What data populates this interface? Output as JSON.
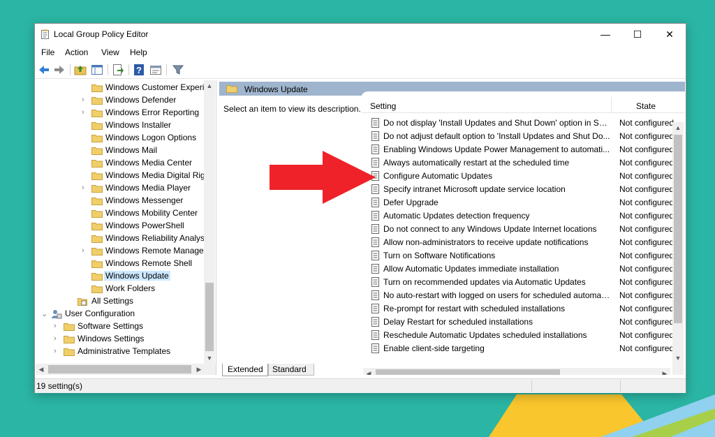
{
  "colors": {
    "desktop": "#2bb5a4",
    "accent_yellow": "#f9c62d",
    "accent_blue": "#8fd1ee",
    "arrow": "#ee2228",
    "header_bar": "#9fb4cd",
    "selected": "#cce8ff"
  },
  "window": {
    "title": "Local Group Policy Editor",
    "controls": {
      "minimize": "—",
      "maximize": "☐",
      "close": "✕"
    }
  },
  "menu": [
    "File",
    "Action",
    "View",
    "Help"
  ],
  "toolbar_icons": [
    "back-icon",
    "forward-icon",
    "up-folder-icon",
    "show-hide-tree-icon",
    "export-list-icon",
    "help-icon",
    "properties-icon",
    "filter-icon"
  ],
  "tree": [
    {
      "label": "Windows Customer Experi",
      "expandable": false
    },
    {
      "label": "Windows Defender",
      "expandable": true
    },
    {
      "label": "Windows Error Reporting",
      "expandable": true
    },
    {
      "label": "Windows Installer",
      "expandable": false
    },
    {
      "label": "Windows Logon Options",
      "expandable": false
    },
    {
      "label": "Windows Mail",
      "expandable": false
    },
    {
      "label": "Windows Media Center",
      "expandable": false
    },
    {
      "label": "Windows Media Digital Rig",
      "expandable": false
    },
    {
      "label": "Windows Media Player",
      "expandable": true
    },
    {
      "label": "Windows Messenger",
      "expandable": false
    },
    {
      "label": "Windows Mobility Center",
      "expandable": false
    },
    {
      "label": "Windows PowerShell",
      "expandable": false
    },
    {
      "label": "Windows Reliability Analys",
      "expandable": false
    },
    {
      "label": "Windows Remote Manage",
      "expandable": true
    },
    {
      "label": "Windows Remote Shell",
      "expandable": false
    },
    {
      "label": "Windows Update",
      "expandable": false,
      "selected": true
    },
    {
      "label": "Work Folders",
      "expandable": false
    }
  ],
  "tree_all_settings": "All Settings",
  "tree_user_config": "User Configuration",
  "tree_user_children": [
    "Software Settings",
    "Windows Settings",
    "Administrative Templates"
  ],
  "pane_title": "Windows Update",
  "description_hint": "Select an item to view its description.",
  "columns": {
    "setting": "Setting",
    "state": "State"
  },
  "settings": [
    {
      "name": "Do not display 'Install Updates and Shut Down' option in Sh...",
      "state": "Not configured"
    },
    {
      "name": "Do not adjust default option to 'Install Updates and Shut Do...",
      "state": "Not configured"
    },
    {
      "name": "Enabling Windows Update Power Management to automati...",
      "state": "Not configured"
    },
    {
      "name": "Always automatically restart at the scheduled time",
      "state": "Not configured"
    },
    {
      "name": "Configure Automatic Updates",
      "state": "Not configured"
    },
    {
      "name": "Specify intranet Microsoft update service location",
      "state": "Not configured"
    },
    {
      "name": "Defer Upgrade",
      "state": "Not configured"
    },
    {
      "name": "Automatic Updates detection frequency",
      "state": "Not configured"
    },
    {
      "name": "Do not connect to any Windows Update Internet locations",
      "state": "Not configured"
    },
    {
      "name": "Allow non-administrators to receive update notifications",
      "state": "Not configured"
    },
    {
      "name": "Turn on Software Notifications",
      "state": "Not configured"
    },
    {
      "name": "Allow Automatic Updates immediate installation",
      "state": "Not configured"
    },
    {
      "name": "Turn on recommended updates via Automatic Updates",
      "state": "Not configured"
    },
    {
      "name": "No auto-restart with logged on users for scheduled automat...",
      "state": "Not configured"
    },
    {
      "name": "Re-prompt for restart with scheduled installations",
      "state": "Not configured"
    },
    {
      "name": "Delay Restart for scheduled installations",
      "state": "Not configured"
    },
    {
      "name": "Reschedule Automatic Updates scheduled installations",
      "state": "Not configured"
    },
    {
      "name": "Enable client-side targeting",
      "state": "Not configured"
    }
  ],
  "tabs": [
    "Extended",
    "Standard"
  ],
  "status": "19 setting(s)"
}
